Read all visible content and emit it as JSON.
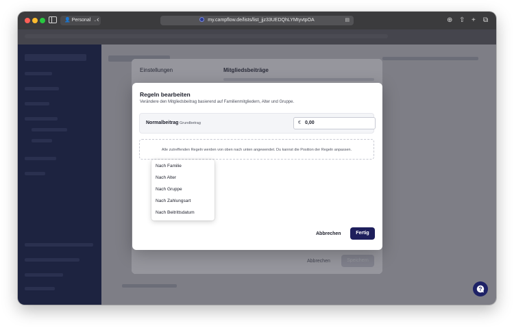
{
  "browser": {
    "profile_label": "Personal",
    "profile_chevron": "⌄",
    "back_glyph": "‹",
    "url": "my.campflow.de/lists/list_jjz33UEDQhLYMtyvtpOA",
    "reader_glyph": "▤",
    "toolbar_icons": [
      "download-icon",
      "share-icon",
      "new-tab-icon",
      "tabs-overview-icon"
    ],
    "toolbar_glyphs": [
      "⊕",
      "⇧",
      "+",
      "⧉"
    ]
  },
  "settings_panel": {
    "left_title": "Einstellungen",
    "right_title": "Mitgliedsbeiträge",
    "cancel_label": "Abbrechen",
    "save_label": "Speichern"
  },
  "dialog": {
    "title": "Regeln bearbeiten",
    "subtitle": "Verändere den Mitgliedsbeitrag basierend auf Familienmitgliedern, Alter und Gruppe.",
    "rule": {
      "name": "Normalbeitrag",
      "tag": "Grundbetrag",
      "currency": "€",
      "value": "0,00"
    },
    "drop_text": "Alle zutreffenden Regeln werden von oben nach unten angewendet. Du kannst die Position der Regeln anpassen.",
    "menu_items": [
      "Nach Familie",
      "Nach Alter",
      "Nach Gruppe",
      "Nach Zahlungsart",
      "Nach Beitrittsdatum"
    ],
    "cancel_label": "Abbrechen",
    "done_label": "Fertig"
  },
  "colors": {
    "sidebar": "#0f1d55",
    "primary_button": "#1e1f5c",
    "help_button": "#1e2266"
  }
}
